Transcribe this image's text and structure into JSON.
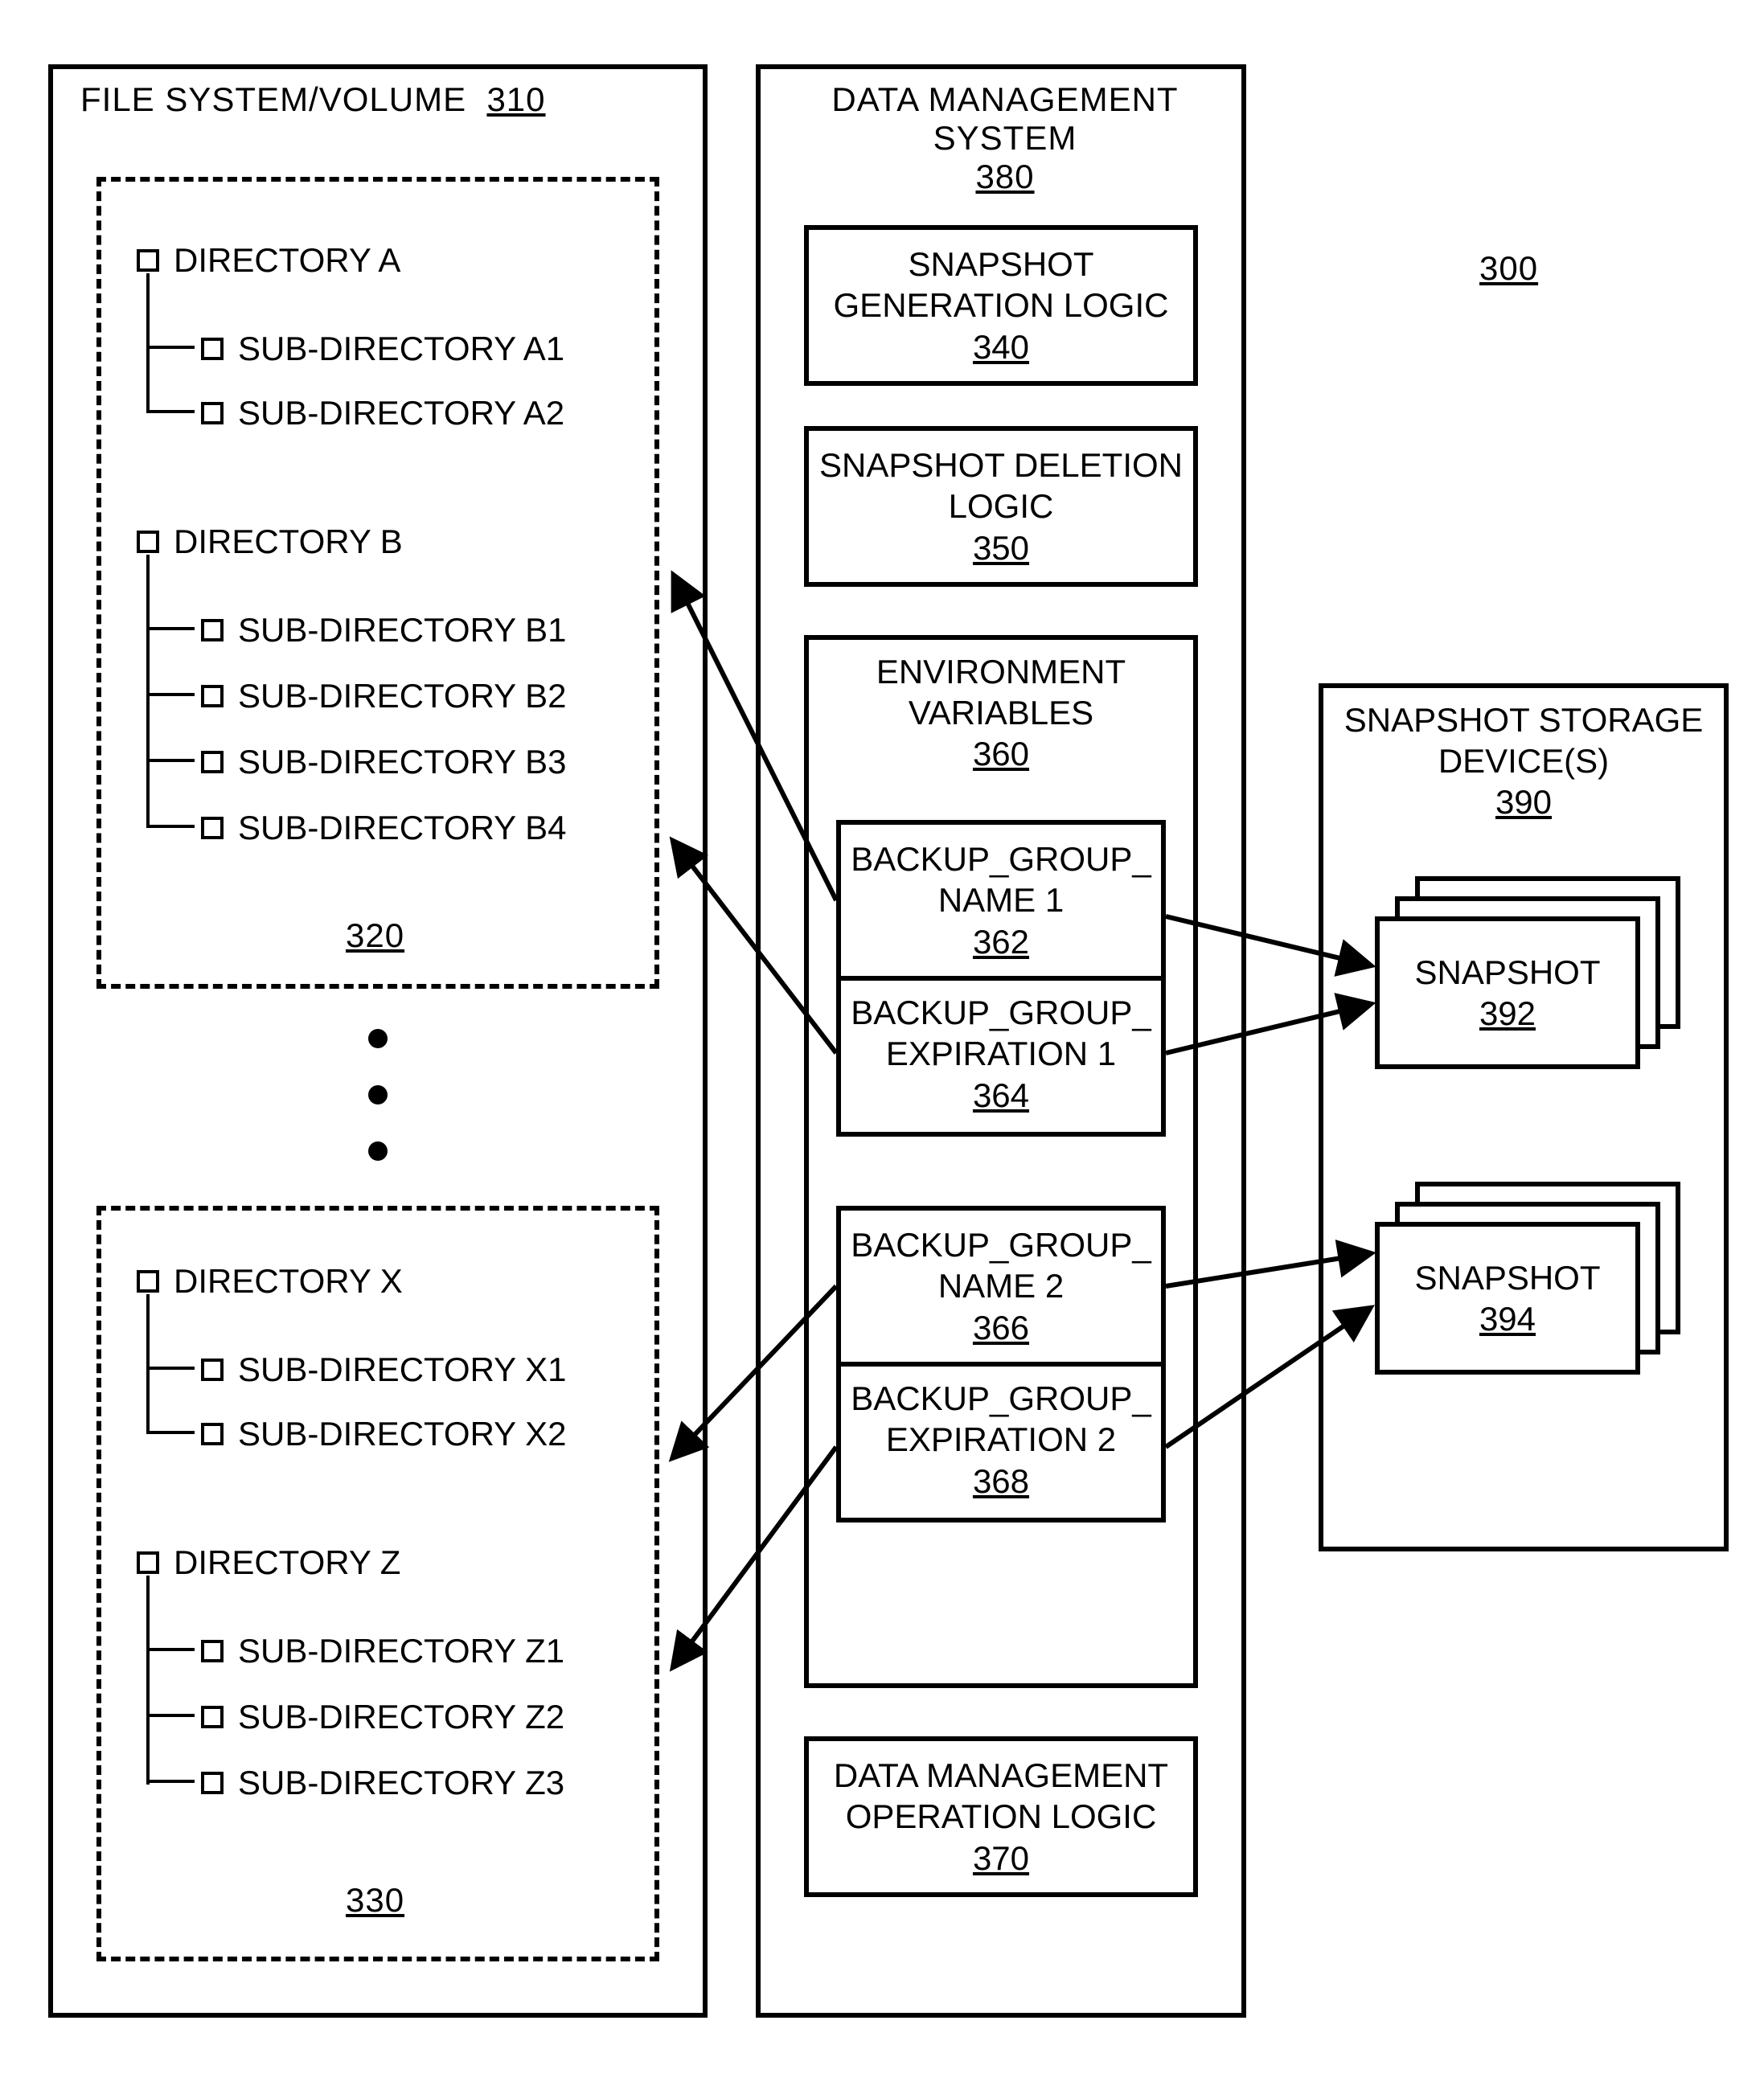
{
  "figure_ref": "300",
  "file_system": {
    "title": "FILE SYSTEM/VOLUME",
    "ref": "310",
    "group1": {
      "ref": "320",
      "dirA": {
        "label": "DIRECTORY A",
        "subs": [
          "SUB-DIRECTORY A1",
          "SUB-DIRECTORY A2"
        ]
      },
      "dirB": {
        "label": "DIRECTORY B",
        "subs": [
          "SUB-DIRECTORY B1",
          "SUB-DIRECTORY B2",
          "SUB-DIRECTORY B3",
          "SUB-DIRECTORY B4"
        ]
      }
    },
    "group2": {
      "ref": "330",
      "dirX": {
        "label": "DIRECTORY X",
        "subs": [
          "SUB-DIRECTORY X1",
          "SUB-DIRECTORY X2"
        ]
      },
      "dirZ": {
        "label": "DIRECTORY Z",
        "subs": [
          "SUB-DIRECTORY Z1",
          "SUB-DIRECTORY Z2",
          "SUB-DIRECTORY Z3"
        ]
      }
    }
  },
  "dms": {
    "title": "DATA MANAGEMENT SYSTEM",
    "ref": "380",
    "snap_gen": {
      "line1": "SNAPSHOT",
      "line2": "GENERATION LOGIC",
      "ref": "340"
    },
    "snap_del": {
      "line1": "SNAPSHOT DELETION",
      "line2": "LOGIC",
      "ref": "350"
    },
    "env": {
      "line1": "ENVIRONMENT",
      "line2": "VARIABLES",
      "ref": "360",
      "bgn1": {
        "line1": "BACKUP_GROUP_",
        "line2": "NAME  1",
        "ref": "362"
      },
      "bge1": {
        "line1": "BACKUP_GROUP_",
        "line2": "EXPIRATION 1",
        "ref": "364"
      },
      "bgn2": {
        "line1": "BACKUP_GROUP_",
        "line2": "NAME  2",
        "ref": "366"
      },
      "bge2": {
        "line1": "BACKUP_GROUP_",
        "line2": "EXPIRATION 2",
        "ref": "368"
      }
    },
    "op_logic": {
      "line1": "DATA MANAGEMENT",
      "line2": "OPERATION LOGIC",
      "ref": "370"
    }
  },
  "storage": {
    "title_l1": "SNAPSHOT STORAGE",
    "title_l2": "DEVICE(S)",
    "ref": "390",
    "snap1": {
      "label": "SNAPSHOT",
      "ref": "392"
    },
    "snap2": {
      "label": "SNAPSHOT",
      "ref": "394"
    }
  }
}
